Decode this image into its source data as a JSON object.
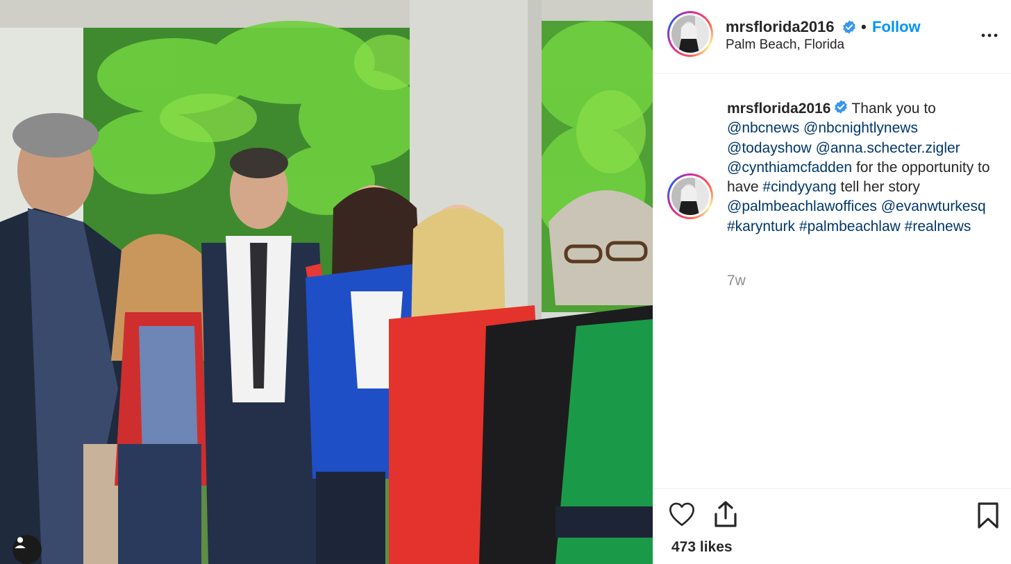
{
  "post": {
    "username": "mrsflorida2016",
    "follow_label": "Follow",
    "separator": "•",
    "location": "Palm Beach, Florida",
    "caption": {
      "username": "mrsflorida2016",
      "line1_text": "Thank you to",
      "mention_1": "@nbcnews",
      "mention_2": "@nbcnightlynews",
      "mention_3": "@todayshow",
      "mention_4": "@anna.schecter.zigler",
      "mention_5": "@cynthiamcfadden",
      "mid_text": "for the opportunity to have",
      "hashtag_1": "#cindyyang",
      "tail_text": "tell her story",
      "mention_6": "@palmbeachlawoffices",
      "mention_7": "@evanwturkesq",
      "hashtag_2": "#karynturk",
      "hashtag_3": "#palmbeachlaw",
      "hashtag_4": "#realnews"
    },
    "timestamp": "7w",
    "likes": "473 likes"
  },
  "icons": {
    "verified": "verified-badge-icon",
    "more": "more-options-icon",
    "like": "heart-icon",
    "share": "share-icon",
    "save": "bookmark-icon",
    "tag_people": "user-icon"
  },
  "colors": {
    "link_blue": "#0095f6",
    "mention_blue": "#00376b",
    "verified_blue": "#3897f0",
    "muted_gray": "#8e8e8e"
  }
}
